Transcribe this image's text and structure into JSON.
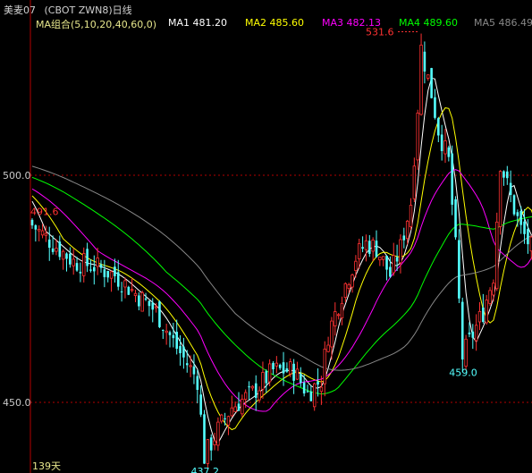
{
  "header": {
    "instrument": "美麦07",
    "contract": "(CBOT ZWN8)日线",
    "ma_group": "MA组合(5,10,20,40,60,0)",
    "ma_items": [
      {
        "label": "MA1 481.20",
        "color": "#ffffff"
      },
      {
        "label": "MA2 485.60",
        "color": "#ffff00"
      },
      {
        "label": "MA3 482.13",
        "color": "#ff00ff"
      },
      {
        "label": "MA4 489.60",
        "color": "#00ff00"
      },
      {
        "label": "MA5 486.49",
        "color": "#888888"
      }
    ]
  },
  "colors": {
    "background": "#000000",
    "axis": "#b40000",
    "up": "#ff3232",
    "down": "#54ffff",
    "max_label": "#ff3232",
    "min_label": "#54ffff",
    "header_group": "#e6e68c",
    "header_instrument": "#d0d0d0"
  },
  "chart_data": {
    "type": "candlestick",
    "period_label": "139天",
    "ylim": [
      437,
      535
    ],
    "y_ticks": [
      {
        "value": 450,
        "label": "450.0"
      },
      {
        "value": 500,
        "label": "500.0"
      }
    ],
    "markers": [
      {
        "label": "531.6",
        "value": 531.6,
        "index": 113,
        "kind": "max",
        "arrow": true
      },
      {
        "label": "491.6",
        "value": 491.6,
        "index": 0,
        "kind": "left"
      },
      {
        "label": "459.0",
        "value": 459.0,
        "index": 125,
        "kind": "min"
      },
      {
        "label": "437.2",
        "value": 437.2,
        "index": 50,
        "kind": "min"
      }
    ],
    "close_path": [
      [
        0,
        489
      ],
      [
        6,
        485
      ],
      [
        12,
        481
      ],
      [
        18,
        480
      ],
      [
        24,
        478
      ],
      [
        30,
        474
      ],
      [
        36,
        470
      ],
      [
        42,
        462
      ],
      [
        48,
        455
      ],
      [
        50,
        438
      ],
      [
        54,
        444
      ],
      [
        58,
        449
      ],
      [
        64,
        452
      ],
      [
        70,
        457
      ],
      [
        76,
        457
      ],
      [
        80,
        452
      ],
      [
        84,
        455
      ],
      [
        86,
        465
      ],
      [
        90,
        474
      ],
      [
        94,
        482
      ],
      [
        97,
        485
      ],
      [
        100,
        484
      ],
      [
        104,
        478
      ],
      [
        107,
        484
      ],
      [
        110,
        494
      ],
      [
        112,
        515
      ],
      [
        113,
        528
      ],
      [
        116,
        518
      ],
      [
        118,
        510
      ],
      [
        121,
        503
      ],
      [
        123,
        484
      ],
      [
        125,
        460
      ],
      [
        128,
        465
      ],
      [
        131,
        470
      ],
      [
        134,
        478
      ],
      [
        136,
        503
      ],
      [
        139,
        495
      ],
      [
        142,
        488
      ],
      [
        145,
        484
      ],
      [
        148,
        477
      ]
    ],
    "ma_specs": [
      {
        "name": "MA1",
        "period": 5,
        "color": "#ffffff"
      },
      {
        "name": "MA2",
        "period": 10,
        "color": "#ffff00"
      },
      {
        "name": "MA3",
        "period": 20,
        "color": "#ff00ff"
      },
      {
        "name": "MA4",
        "period": 40,
        "color": "#00ff00"
      },
      {
        "name": "MA5",
        "period": 60,
        "color": "#888888"
      }
    ]
  }
}
